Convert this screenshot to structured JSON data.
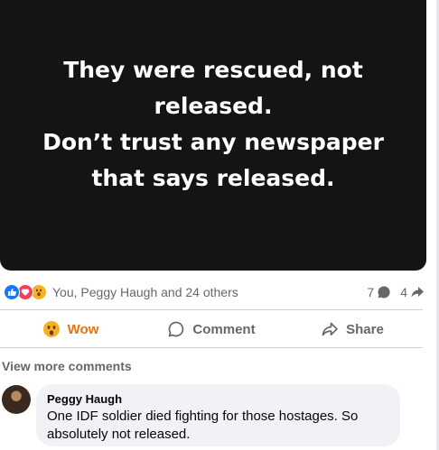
{
  "post": {
    "text": "They were rescued, not\nreleased.\nDon’t trust any newspaper\nthat says released.",
    "background_color": "#141414"
  },
  "reactions": {
    "icons": [
      "like-icon",
      "love-icon",
      "wow-icon"
    ],
    "summary": "You, Peggy Haugh and 24 others",
    "comment_count": "7",
    "share_count": "4"
  },
  "actions": {
    "wow_label": "Wow",
    "comment_label": "Comment",
    "share_label": "Share",
    "wow_color": "#e9710f"
  },
  "comments": {
    "view_more_label": "View more comments",
    "items": [
      {
        "author": "Peggy Haugh",
        "text": "One IDF soldier died fighting for those hostages. So absolutely not released."
      }
    ]
  }
}
